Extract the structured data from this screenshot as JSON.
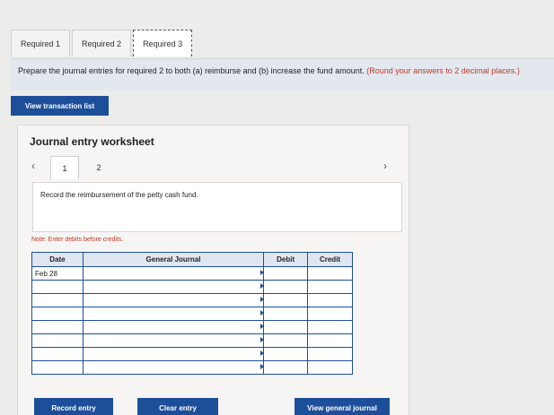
{
  "tabs": [
    "Required 1",
    "Required 2",
    "Required 3"
  ],
  "instructions": {
    "text": "Prepare the journal entries for required 2 to both (a) reimburse and (b) increase the fund amount.",
    "note": "(Round your answers to 2 decimal places.)"
  },
  "view_transactions_label": "View transaction list",
  "worksheet": {
    "title": "Journal entry worksheet",
    "pages": [
      "1",
      "2"
    ],
    "record_text": "Record the reimbursement of the petty cash fund.",
    "note": "Note: Enter debits before credits."
  },
  "journal": {
    "headers": [
      "Date",
      "General Journal",
      "Debit",
      "Credit"
    ],
    "rows": [
      [
        "Feb 28",
        "",
        "",
        ""
      ],
      [
        "",
        "",
        "",
        ""
      ],
      [
        "",
        "",
        "",
        ""
      ],
      [
        "",
        "",
        "",
        ""
      ],
      [
        "",
        "",
        "",
        ""
      ],
      [
        "",
        "",
        "",
        ""
      ],
      [
        "",
        "",
        "",
        ""
      ],
      [
        "",
        "",
        "",
        ""
      ]
    ]
  },
  "buttons": {
    "record": "Record entry",
    "clear": "Clear entry",
    "view_journal": "View general journal"
  },
  "colors": {
    "accent": "#1d4e9a",
    "warning": "#c0392b"
  },
  "icons": {
    "prev": "chevron-left-icon",
    "next": "chevron-right-icon"
  }
}
